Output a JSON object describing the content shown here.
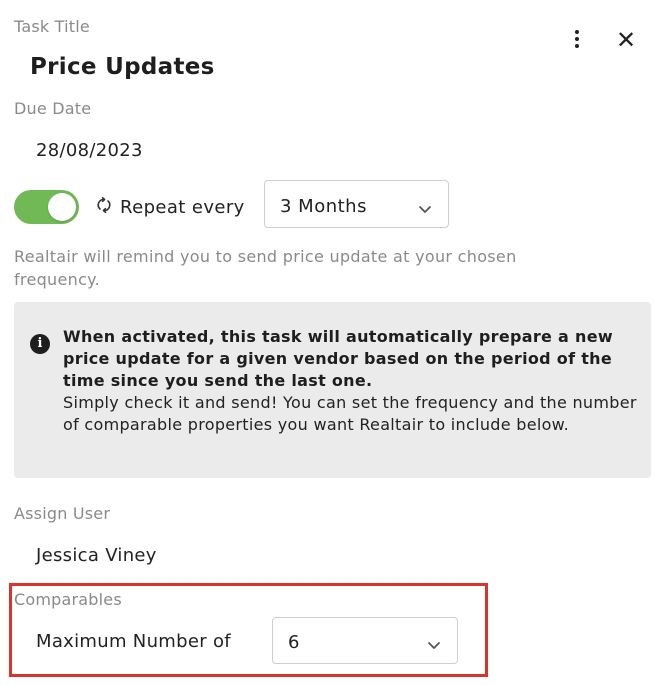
{
  "task": {
    "title_label": "Task Title",
    "title_value": "Price Updates",
    "due_label": "Due Date",
    "due_value": "28/08/2023"
  },
  "header": {
    "more_icon": "kebab-vertical-icon",
    "close_icon": "close-icon",
    "close_glyph": "✕"
  },
  "repeat": {
    "enabled": true,
    "icon": "repeat-icon",
    "label": "Repeat every",
    "frequency": "3 Months"
  },
  "help_text": "Realtair will remind you to send price update at your chosen frequency.",
  "info": {
    "icon": "info-icon",
    "icon_glyph": "i",
    "bold_text": "When activated, this task will automatically prepare a new price update for a given vendor based on the period of the time since you send the last one.",
    "body_text": "Simply check it and send! You can set the frequency and the number of comparable properties you want Realtair to include below."
  },
  "assign": {
    "label": "Assign User",
    "value": "Jessica Viney"
  },
  "comparables": {
    "label": "Comparables",
    "max_label": "Maximum Number of",
    "max_value": "6"
  },
  "colors": {
    "toggle_on": "#71b856",
    "highlight": "#d9342b",
    "info_bg": "#ebebeb"
  }
}
